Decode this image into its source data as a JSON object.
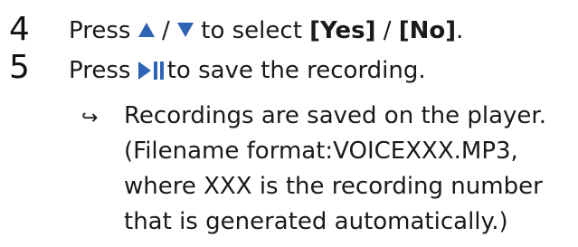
{
  "steps": [
    {
      "number": "4",
      "pre": "Press",
      "sep": "/",
      "mid": "to select",
      "yes": "[Yes]",
      "slash": "/",
      "no": "[No]",
      "end": "."
    },
    {
      "number": "5",
      "pre": "Press",
      "post": "to save the recording."
    }
  ],
  "result": {
    "arrow": "↪",
    "lines": [
      "Recordings are saved on the player.",
      "(Filename format:VOICEXXX.MP3,",
      "where XXX is the recording number",
      "that is generated automatically.)"
    ]
  },
  "icons": {
    "up": "triangle-up-icon",
    "down": "triangle-down-icon",
    "play_pause": "play-pause-icon",
    "accent_color": "#2e63b5"
  }
}
